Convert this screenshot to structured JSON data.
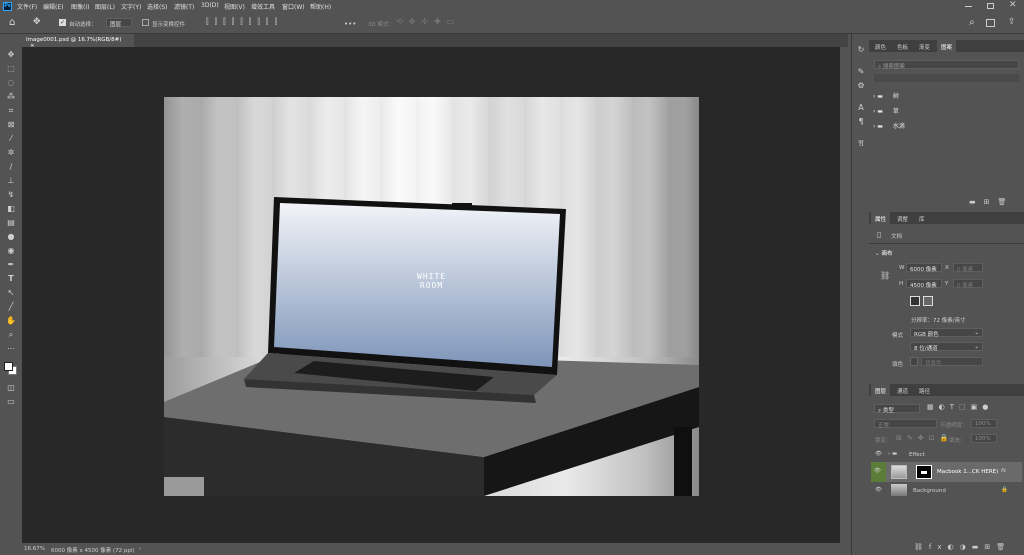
{
  "app": {
    "logo": "Ps"
  },
  "menubar": {
    "items": [
      "文件(F)",
      "编辑(E)",
      "图像(I)",
      "图层(L)",
      "文字(Y)",
      "选择(S)",
      "滤镜(T)",
      "3D(D)",
      "视图(V)",
      "增效工具",
      "窗口(W)",
      "帮助(H)"
    ]
  },
  "options": {
    "auto_select_label": "自动选择：",
    "auto_select_value": "图层",
    "show_transform_label": "显示变换控件",
    "mode_3d_label": "3D 模式：",
    "more": "•••"
  },
  "document": {
    "tab_title": "Image0001.psd @ 16.7%(RGB/8#)",
    "zoom": "16.67%",
    "dimensions": "6000 像素 x 4500 像素 (72 ppi)"
  },
  "mockup": {
    "screen_line1": "WHITE",
    "screen_line2": "ROOM"
  },
  "panel_top": {
    "tabs": [
      "颜色",
      "色板",
      "渐变",
      "图案"
    ],
    "search_placeholder": "搜索图案",
    "folders": [
      "树",
      "草",
      "水滴"
    ]
  },
  "properties": {
    "tabs": [
      "属性",
      "调整",
      "库"
    ],
    "doc_label": "文档",
    "section": "画布",
    "w_label": "W",
    "w_value": "6000 像素",
    "h_label": "H",
    "h_value": "4500 像素",
    "x_label": "X",
    "y_label": "Y",
    "x_value": "0 像素",
    "y_value": "0 像素",
    "resolution": "分辨率：72 像素/英寸",
    "mode_label": "模式",
    "mode_value": "RGB 颜色",
    "depth_value": "8 位/通道",
    "fill_label": "填色",
    "fill_value": "背景色"
  },
  "layers": {
    "tabs": [
      "图层",
      "通道",
      "路径"
    ],
    "filter_label": "类型",
    "blend_mode": "正常",
    "opacity_label": "不透明度：",
    "opacity_value": "100%",
    "lock_label": "锁定：",
    "fill_label": "填充：",
    "fill_value": "100%",
    "items": [
      {
        "name": "Effect",
        "type": "group"
      },
      {
        "name": "Macbook 1...CK HERE)",
        "type": "smart",
        "fx": "fx"
      },
      {
        "name": "Background",
        "type": "image"
      }
    ]
  },
  "colors": {
    "accent_green": "#5c7d3a",
    "panel_bg": "#535353",
    "canvas_bg": "#282828"
  }
}
